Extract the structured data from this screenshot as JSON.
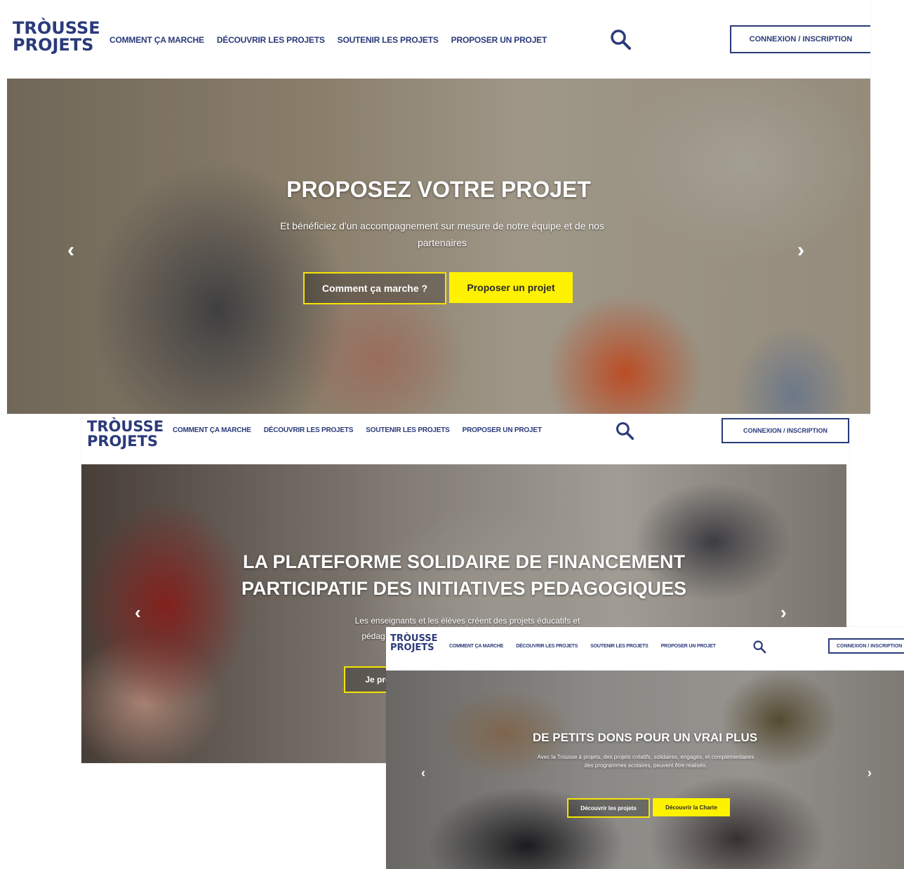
{
  "brand": {
    "logo_line1": "TRÒUSSE",
    "logo_line2": "PROJETS"
  },
  "nav": {
    "items": [
      "COMMENT ÇA MARCHE",
      "DÉCOUVRIR LES PROJETS",
      "SOUTENIR LES PROJETS",
      "PROPOSER UN PROJET"
    ],
    "login_label": "CONNEXION / INSCRIPTION"
  },
  "slides": [
    {
      "title": "PROPOSEZ VOTRE PROJET",
      "subtitle": "Et bénéficiez d'un accompagnement sur mesure de notre équipe et de nos partenaires",
      "btn_outline": "Comment ça marche ?",
      "btn_yellow": "Proposer un projet"
    },
    {
      "title_line1": "LA PLATEFORME SOLIDAIRE DE FINANCEMENT",
      "title_line2": "PARTICIPATIF DES INITIATIVES PEDAGOGIQUES",
      "subtitle": "Les enseignants et les élèves créent des projets éducatifs et",
      "subtitle2": "pédag",
      "btn_outline": "Je prop"
    },
    {
      "title": "DE PETITS DONS POUR UN VRAI PLUS",
      "subtitle": "Avec la Trousse à projets, des projets créatifs, solidaires, engagés, et complémentaires des programmes scolaires, peuvent être réalisés.",
      "btn_outline": "Découvrir les projets",
      "btn_yellow": "Découvrir la Charte"
    }
  ],
  "icons": {
    "search": "search-icon",
    "prev": "chevron-left-icon",
    "next": "chevron-right-icon"
  },
  "colors": {
    "brand": "#2a3a7a",
    "accent_yellow": "#fff200"
  }
}
